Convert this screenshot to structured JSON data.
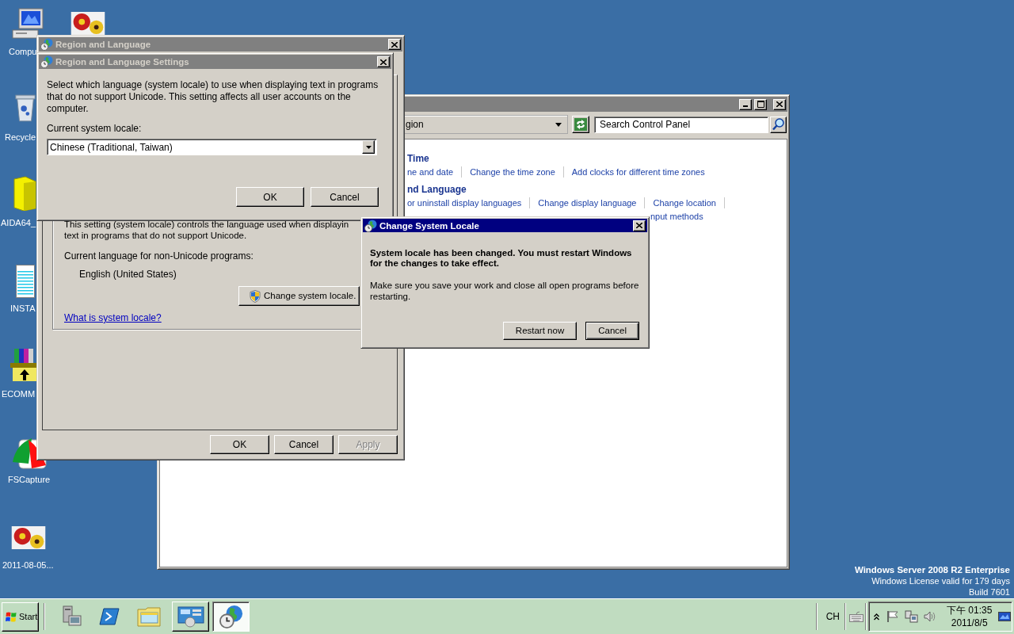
{
  "desktop": {
    "icons": [
      {
        "kind": "computer",
        "label": "Compu"
      },
      {
        "kind": "picture"
      },
      {
        "kind": "recycle-bin",
        "label": "Recycle"
      },
      {
        "kind": "folder",
        "label": "AIDA64_"
      },
      {
        "kind": "document",
        "label": "INSTA"
      },
      {
        "kind": "installer",
        "label": "ECOMM"
      },
      {
        "kind": "capture",
        "label": "FSCapture"
      },
      {
        "kind": "picture",
        "label": "2011-08-05..."
      }
    ],
    "edition": [
      "Windows Server 2008 R2 Enterprise",
      "Windows License valid for 179 days",
      "Build 7601"
    ]
  },
  "control_panel": {
    "active": false,
    "address": "gion",
    "search": {
      "placeholder": "Search Control Panel"
    },
    "sections": [
      {
        "heading": "Time",
        "links": [
          "ne and date",
          "Change the time zone",
          "Add clocks for different time zones"
        ]
      },
      {
        "heading": "nd Language",
        "links": [
          "or uninstall display languages",
          "Change display language",
          "Change location"
        ],
        "more_links": [
          "nput methods"
        ]
      }
    ]
  },
  "region_window": {
    "title": "Region and Language",
    "active": false,
    "description": "This setting (system locale) controls the language used when displayin\ntext in programs that do not support Unicode.",
    "current_label": "Current language for non-Unicode programs:",
    "current_value": "English (United States)",
    "change_button": "Change system locale.",
    "help_link": "What is system locale?",
    "buttons": [
      {
        "label": "OK",
        "disabled": false
      },
      {
        "label": "Cancel",
        "disabled": false
      },
      {
        "label": "Apply",
        "disabled": true
      }
    ]
  },
  "settings_dialog": {
    "title": "Region and Language Settings",
    "active": false,
    "description": "Select which language (system locale) to use when displaying text in programs\nthat do not support Unicode. This setting affects all user accounts on the\ncomputer.",
    "locale_label": "Current system locale:",
    "locale_value": "Chinese (Traditional, Taiwan)",
    "buttons": [
      "OK",
      "Cancel"
    ]
  },
  "locale_dialog": {
    "title": "Change System Locale",
    "active": true,
    "message": "System locale has been changed. You must restart Windows\nfor the changes to take effect.",
    "note": "Make sure you save your work and close all open programs before\nrestarting.",
    "buttons": [
      {
        "label": "Restart now",
        "default": false
      },
      {
        "label": "Cancel",
        "default": true
      }
    ]
  },
  "taskbar": {
    "start": "Start",
    "quick_launch": [
      {
        "kind": "server"
      },
      {
        "kind": "terminal"
      },
      {
        "kind": "explorer"
      }
    ],
    "windows": [
      {
        "kind": "control-panel",
        "selected": false
      },
      {
        "kind": "region",
        "selected": true
      }
    ],
    "language": "CH",
    "clock": {
      "time": "下午 01:35",
      "date": "2011/8/5"
    }
  }
}
